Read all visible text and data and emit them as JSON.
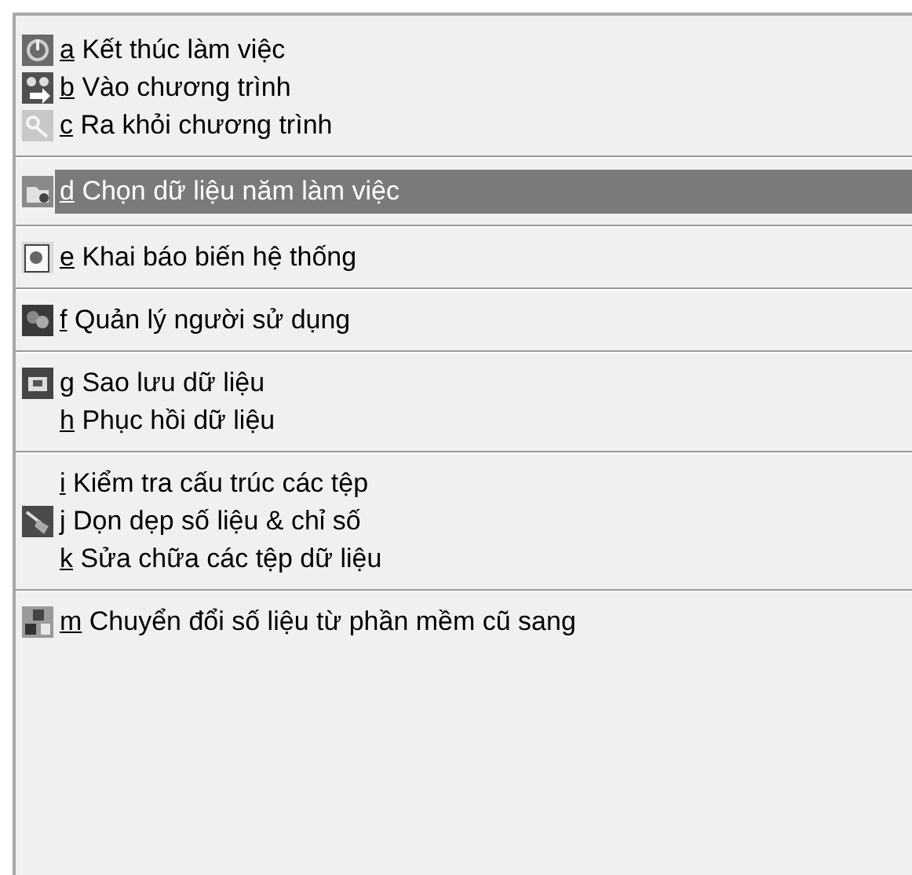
{
  "menu": {
    "groups": [
      {
        "items": [
          {
            "key": "a",
            "label": "Kết thúc làm việc",
            "icon": true,
            "selected": false
          },
          {
            "key": "b",
            "label": "Vào chương trình",
            "icon": true,
            "selected": false
          },
          {
            "key": "c",
            "label": "Ra khỏi chương trình",
            "icon": true,
            "selected": false
          }
        ]
      },
      {
        "items": [
          {
            "key": "d",
            "label": "Chọn dữ liệu năm làm việc",
            "icon": true,
            "selected": true
          }
        ]
      },
      {
        "items": [
          {
            "key": "e",
            "label": "Khai báo biến hệ thống",
            "icon": true,
            "selected": false
          }
        ]
      },
      {
        "items": [
          {
            "key": "f",
            "label": "Quản lý người sử dụng",
            "icon": true,
            "selected": false
          }
        ]
      },
      {
        "items": [
          {
            "key": "g",
            "label": "Sao lưu dữ liệu",
            "icon": true,
            "selected": false
          },
          {
            "key": "h",
            "label": "Phục hồi dữ liệu",
            "icon": false,
            "selected": false
          }
        ]
      },
      {
        "items": [
          {
            "key": "i",
            "label": "Kiểm tra cấu trúc các tệp",
            "icon": false,
            "selected": false
          },
          {
            "key": "j",
            "label": "Dọn dẹp số liệu & chỉ số",
            "icon": true,
            "selected": false
          },
          {
            "key": "k",
            "label": "Sửa chữa các tệp dữ liệu",
            "icon": false,
            "selected": false
          }
        ]
      },
      {
        "items": [
          {
            "key": "m",
            "label": "Chuyển đổi số liệu từ phần mềm cũ sang",
            "icon": true,
            "selected": false
          }
        ]
      }
    ]
  }
}
